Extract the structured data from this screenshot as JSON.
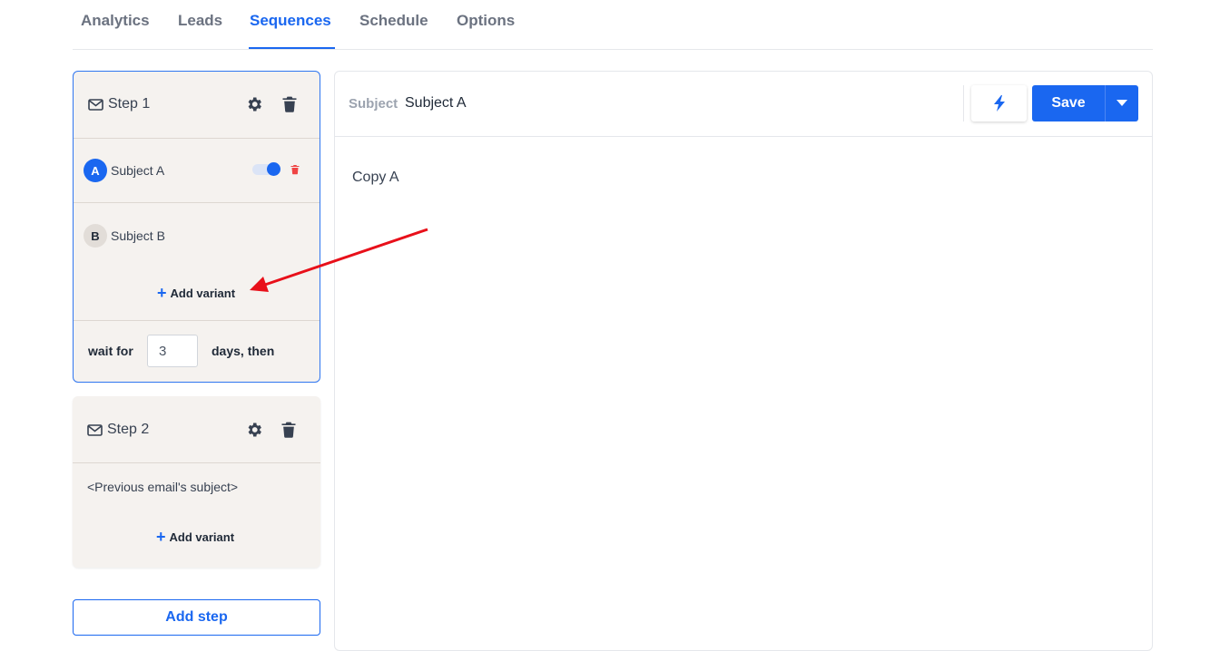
{
  "tabs": [
    {
      "label": "Analytics",
      "active": false
    },
    {
      "label": "Leads",
      "active": false
    },
    {
      "label": "Sequences",
      "active": true
    },
    {
      "label": "Schedule",
      "active": false
    },
    {
      "label": "Options",
      "active": false
    }
  ],
  "steps": [
    {
      "title": "Step 1",
      "variants": [
        {
          "badge": "A",
          "subject": "Subject A",
          "enabled": true
        },
        {
          "badge": "B",
          "subject": "Subject B"
        }
      ],
      "add_variant_label": "Add variant",
      "wait_prefix": "wait for",
      "wait_days": "3",
      "wait_suffix": "days, then"
    },
    {
      "title": "Step 2",
      "subject_placeholder": "<Previous email's subject>",
      "add_variant_label": "Add variant"
    }
  ],
  "add_step_label": "Add step",
  "editor": {
    "subject_label": "Subject",
    "subject_value": "Subject A",
    "save_label": "Save",
    "body": "Copy A"
  },
  "colors": {
    "accent": "#1a67f0",
    "annotation_arrow": "#e8101a",
    "delete_red": "#ef4444"
  },
  "icons": [
    "envelope-icon",
    "gear-icon",
    "trash-icon",
    "lightning-icon",
    "caret-down-icon",
    "plus-icon"
  ]
}
